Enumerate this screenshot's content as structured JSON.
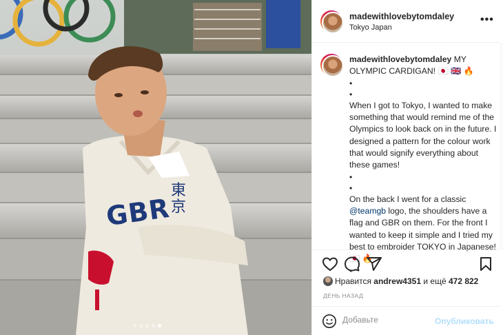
{
  "post": {
    "username": "madewithlovebytomdaley",
    "location": "Tokyo Japan",
    "more_label": "•••"
  },
  "caption": {
    "username": "madewithlovebytomdaley",
    "headline": "MY OLYMPIC CARDIGAN! 🇯🇵 🇬🇧 🔥",
    "bullet": "•",
    "para1": "When I got to Tokyo, I wanted to make something that would remind me of the Olympics to look back on in the future. I designed a pattern for the colour work that would signify everything about these games!",
    "para2_mention": "@teamgb",
    "para2_pre": "On the back I went for a classic ",
    "para2_post": " logo, the shoulders have a flag and GBR on them. For the front I wanted to keep it simple and I tried my best to embroider TOKYO in Japanese! 🇯🇵 🔥"
  },
  "likes": {
    "prefix": "Нравится",
    "user": "andrew4351",
    "middle": "и ещё",
    "count": "472 822"
  },
  "time_label": "ДЕНЬ НАЗАД",
  "comment": {
    "placeholder": "Добавьте",
    "post_label": "Опубликовать"
  },
  "photo": {
    "sweater_text": "GBR",
    "kanji_text": "東京"
  },
  "carousel": {
    "count": 5,
    "active_index": 4
  },
  "colors": {
    "accent_disabled": "#b2dffc",
    "mention": "#00376b",
    "sweater": "#efeadf",
    "gbr_blue": "#1f3a7a",
    "gbr_red": "#c8102e"
  },
  "icons": [
    "heart-icon",
    "comment-icon",
    "share-icon",
    "bookmark-icon",
    "emoji-icon",
    "more-icon"
  ]
}
